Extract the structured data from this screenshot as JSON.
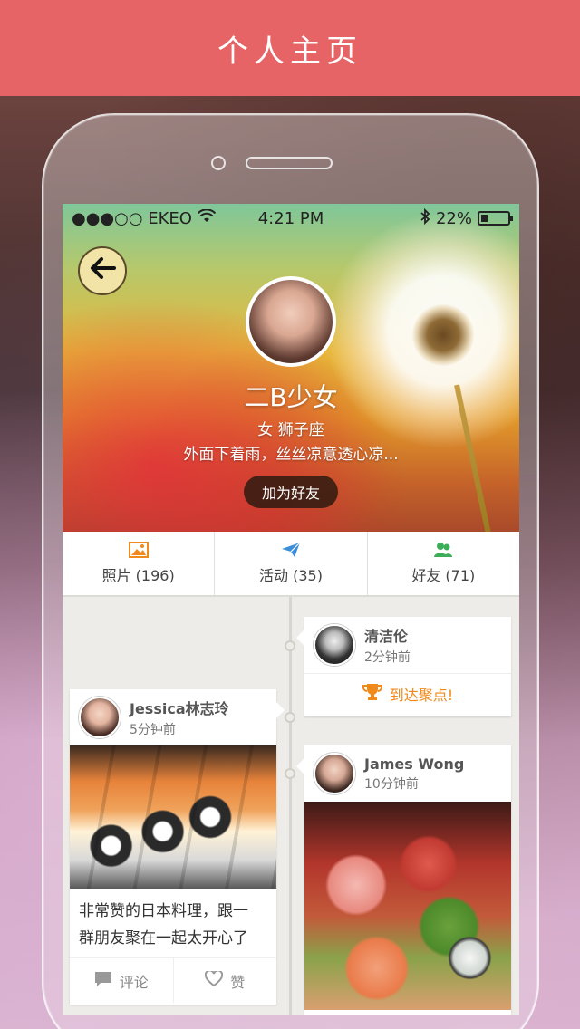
{
  "banner": {
    "title": "个人主页"
  },
  "statusbar": {
    "carrier": "●●●○○ EKEO",
    "time": "4:21 PM",
    "battery": "22%"
  },
  "profile": {
    "name": "二B少女",
    "gender_sign": "女  狮子座",
    "bio": "外面下着雨，丝丝凉意透心凉...",
    "add_friend_label": "加为好友"
  },
  "stats": [
    {
      "label": "照片 (196)",
      "icon": "photo-icon",
      "color": "#f08a1a"
    },
    {
      "label": "活动 (35)",
      "icon": "paper-plane-icon",
      "color": "#3a8fd8"
    },
    {
      "label": "好友 (71)",
      "icon": "friends-icon",
      "color": "#3cae5a"
    }
  ],
  "feed": {
    "right_card_1": {
      "name": "清洁伦",
      "time": "2分钟前",
      "action": "到达聚点!"
    },
    "left_card": {
      "name": "Jessica林志玲",
      "time": "5分钟前",
      "text_line1": "非常赞的日本料理，跟一",
      "text_line2": "群朋友聚在一起太开心了",
      "comment_label": "评论",
      "like_label": "赞"
    },
    "right_card_2": {
      "name": "James Wong",
      "time": "10分钟前"
    }
  }
}
